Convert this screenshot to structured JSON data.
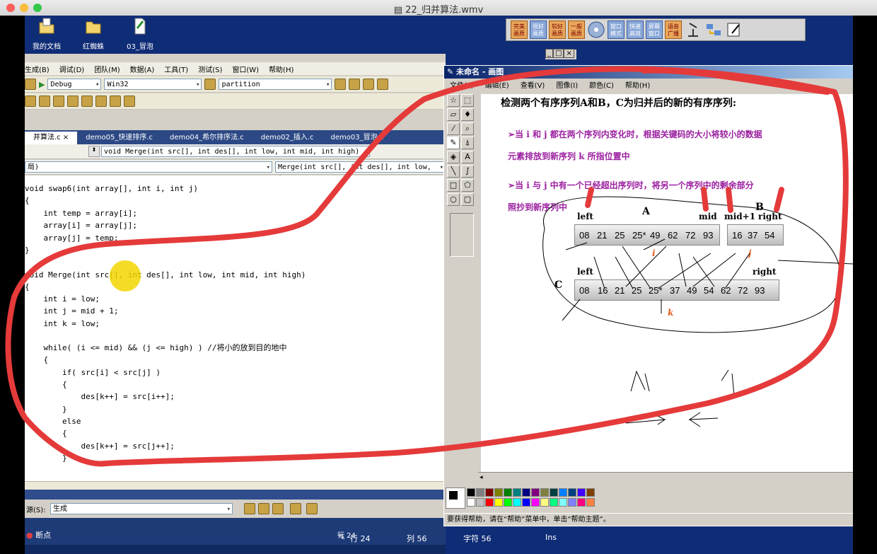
{
  "window": {
    "title": "22_归并算法.wmv"
  },
  "desktop_icons": [
    "我的文档",
    "红蜘蛛",
    "03_冒泡"
  ],
  "player_buttons": [
    "完美画质",
    "很好画质",
    "较好画质",
    "一般画质",
    "窗口模式",
    "快速高效",
    "屏幕窗口",
    "语音广播"
  ],
  "vs": {
    "menu": [
      "生成(B)",
      "调试(D)",
      "团队(M)",
      "数据(A)",
      "工具(T)",
      "测试(S)",
      "窗口(W)",
      "帮助(H)"
    ],
    "config": "Debug",
    "platform": "Win32",
    "find": "partition",
    "tabs": [
      "并算法.c ×",
      "demo05_快速排序.c",
      "demo04_希尔排序法.c",
      "demo02_插入.c",
      "demo03_冒泡.c"
    ],
    "nav_function": "void Merge(int src[], int des[], int low, int mid, int high)",
    "nav_scope": "局)",
    "nav_member": "Merge(int src[], int des[], int low, int",
    "code": [
      "void swap6(int array[], int i, int j)",
      "{",
      "    int temp = array[i];",
      "    array[i] = array[j];",
      "    array[j] = temp;",
      "}",
      "void Merge(int src[], int des[], int low, int mid, int high)",
      "{",
      "    int i = low;",
      "    int j = mid + 1;",
      "    int k = low;",
      "    while( (i <= mid) && (j <= high) ) //将小的放到目的地中",
      "    {",
      "        if( src[i] < src[j] )",
      "        {",
      "            des[k++] = src[i++];",
      "        }",
      "        else",
      "        {",
      "            des[k++] = src[j++];",
      "        }"
    ],
    "output_label": "源(S):",
    "output_source": "生成",
    "breakpoints": "断点",
    "status": {
      "line": "行 24",
      "col": "列 56",
      "char": "字符 56",
      "mode": "Ins"
    }
  },
  "paint": {
    "title": "未命名 - 画图",
    "menu": [
      "文件(F)",
      "编辑(E)",
      "查看(V)",
      "图像(I)",
      "颜色(C)",
      "帮助(H)"
    ],
    "status": "要获得帮助，请在“帮助”菜单中，单击“帮助主题”。",
    "heading": "检测两个有序序列A和B，C为归并后的新的有序序列:",
    "bullet1a": "➢当 i 和 j 都在两个序列内变化时，根据关键码的大小将较小的数据",
    "bullet1b": "元素排放到新序列 k 所指位置中",
    "bullet2a": "➢当 i 与 j 中有一个已经超出序列时，将另一个序列中的剩余部分",
    "bullet2b": "照抄到新序列中",
    "labels": {
      "left": "left",
      "A": "A",
      "mid": "mid",
      "mid1": "mid+1",
      "B": "B",
      "right": "right",
      "C": "C",
      "i": "i",
      "j": "j",
      "k": "k"
    },
    "seqA": [
      "08",
      "21",
      "25",
      "25*",
      "49",
      "62",
      "72",
      "93"
    ],
    "seqB": [
      "16",
      "37",
      "54"
    ],
    "seqC": [
      "08",
      "16",
      "21",
      "25",
      "25*",
      "37",
      "49",
      "54",
      "62",
      "72",
      "93"
    ]
  },
  "colors": {
    "accent": "#0f2c76",
    "annotation": "#e53a3a",
    "highlight": "#f2d600",
    "purple": "#9b1fa0"
  }
}
